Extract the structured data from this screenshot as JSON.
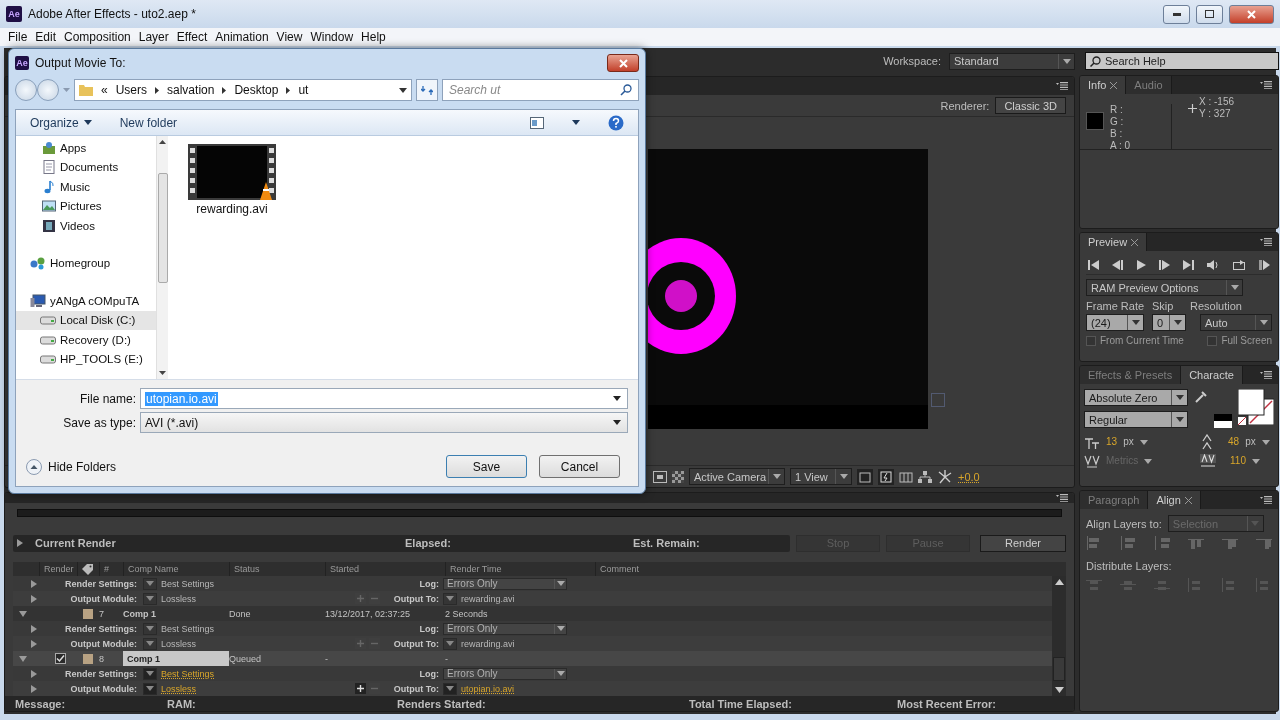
{
  "window": {
    "app_icon": "Ae",
    "title": "Adobe After Effects - uto2.aep *"
  },
  "menu": [
    "File",
    "Edit",
    "Composition",
    "Layer",
    "Effect",
    "Animation",
    "View",
    "Window",
    "Help"
  ],
  "workspace": {
    "label": "Workspace:",
    "value": "Standard"
  },
  "search_help": {
    "placeholder": "Search Help"
  },
  "composition": {
    "renderer_label": "Renderer:",
    "renderer": "Classic 3D",
    "camera": "Active Camera",
    "views": "1 View",
    "exposure": "+0.0"
  },
  "render_queue": {
    "current_render": {
      "label": "Current Render",
      "expanded": false
    },
    "elapsed": "Elapsed:",
    "est_remain": "Est. Remain:",
    "buttons": [
      {
        "label": "Stop",
        "disabled": true
      },
      {
        "label": "Pause",
        "disabled": true
      },
      {
        "label": "Render",
        "disabled": false
      }
    ],
    "columns": [
      "Render",
      "#",
      "Comp Name",
      "Status",
      "Started",
      "Render Time",
      "Comment"
    ],
    "rows": [
      {
        "kind": "settings",
        "expanded": false,
        "label": "Render Settings:",
        "value": "Best Settings",
        "side_label": "Log:",
        "side_value": "Errors Only",
        "highlighted": false
      },
      {
        "kind": "module",
        "expanded": false,
        "label": "Output Module:",
        "value": "Lossless",
        "side_label": "Output To:",
        "side_value": "rewarding.avi",
        "highlighted": false
      },
      {
        "kind": "item",
        "expanded": true,
        "number": "7",
        "name": "Comp 1",
        "status": "Done",
        "started": "13/12/2017, 02:37:25",
        "render_time": "2 Seconds",
        "selected": false
      },
      {
        "kind": "settings",
        "expanded": false,
        "label": "Render Settings:",
        "value": "Best Settings",
        "side_label": "Log:",
        "side_value": "Errors Only",
        "highlighted": false
      },
      {
        "kind": "module",
        "expanded": false,
        "label": "Output Module:",
        "value": "Lossless",
        "side_label": "Output To:",
        "side_value": "rewarding.avi",
        "highlighted": false
      },
      {
        "kind": "item",
        "expanded": true,
        "checked": true,
        "number": "8",
        "name": "Comp 1",
        "status": "Queued",
        "started": "-",
        "render_time": "-",
        "selected": true
      },
      {
        "kind": "settings",
        "expanded": false,
        "label": "Render Settings:",
        "value": "Best Settings",
        "side_label": "Log:",
        "side_value": "Errors Only",
        "highlighted": true
      },
      {
        "kind": "module",
        "expanded": false,
        "label": "Output Module:",
        "value": "Lossless",
        "side_label": "Output To:",
        "side_value": "utopian.io.avi",
        "highlighted": true
      }
    ],
    "status": [
      "Message:",
      "RAM:",
      "Renders Started:",
      "Total Time Elapsed:",
      "Most Recent Error:"
    ]
  },
  "info": {
    "tabs": [
      {
        "label": "Info",
        "selected": true
      },
      {
        "label": "Audio",
        "selected": false
      }
    ],
    "channels": [
      "R :",
      "G :",
      "B :",
      "A : 0"
    ],
    "x": "X : -156",
    "y": "Y : 327"
  },
  "preview": {
    "tab": "Preview",
    "options_menu": "RAM Preview Options",
    "frame_rate_label": "Frame Rate",
    "frame_rate": "(24)",
    "skip_label": "Skip",
    "skip": "0",
    "resolution_label": "Resolution",
    "resolution": "Auto",
    "checks": [
      {
        "label": "From Current Time",
        "checked": false
      },
      {
        "label": "Full Screen",
        "checked": false
      }
    ]
  },
  "character": {
    "tabs": [
      {
        "label": "Effects & Presets",
        "selected": false
      },
      {
        "label": "Characte",
        "selected": true
      }
    ],
    "font": "Absolute Zero",
    "style": "Regular",
    "size": "13",
    "size_unit": "px",
    "leading": "48",
    "leading_unit": "px",
    "kerning": "Metrics",
    "tracking": "110"
  },
  "align": {
    "tabs": [
      {
        "label": "Paragraph",
        "selected": false
      },
      {
        "label": "Align",
        "selected": true
      }
    ],
    "align_to_label": "Align Layers to:",
    "align_to": "Selection",
    "distribute_label": "Distribute Layers:"
  },
  "dialog": {
    "icon": "Ae",
    "title": "Output Movie To:",
    "path_prefix": "«",
    "path": [
      "Users",
      "salvation",
      "Desktop",
      "ut"
    ],
    "search_placeholder": "Search ut",
    "organize": "Organize",
    "new_folder": "New folder",
    "nav_sections": [
      {
        "items": [
          {
            "label": "Apps",
            "kind": "apps",
            "selected": false
          },
          {
            "label": "Documents",
            "kind": "documents",
            "selected": false
          },
          {
            "label": "Music",
            "kind": "music",
            "selected": false
          },
          {
            "label": "Pictures",
            "kind": "pictures",
            "selected": false
          },
          {
            "label": "Videos",
            "kind": "videos",
            "selected": false
          }
        ]
      },
      {
        "items": [
          {
            "label": "Homegroup",
            "kind": "homegroup",
            "selected": false
          }
        ]
      },
      {
        "items": [
          {
            "label": "yANgA cOMpuTA",
            "kind": "computer",
            "selected": false,
            "children": [
              {
                "label": "Local Disk (C:)",
                "kind": "drive",
                "selected": true
              },
              {
                "label": "Recovery (D:)",
                "kind": "drive",
                "selected": false
              },
              {
                "label": "HP_TOOLS (E:)",
                "kind": "drive",
                "selected": false
              }
            ]
          }
        ]
      }
    ],
    "files": [
      {
        "name": "rewarding.avi"
      }
    ],
    "file_name_label": "File name:",
    "file_name": "utopian.io.avi",
    "type_label": "Save as type:",
    "type": "AVI (*.avi)",
    "hide_folders": "Hide Folders",
    "save": "Save",
    "cancel": "Cancel"
  }
}
